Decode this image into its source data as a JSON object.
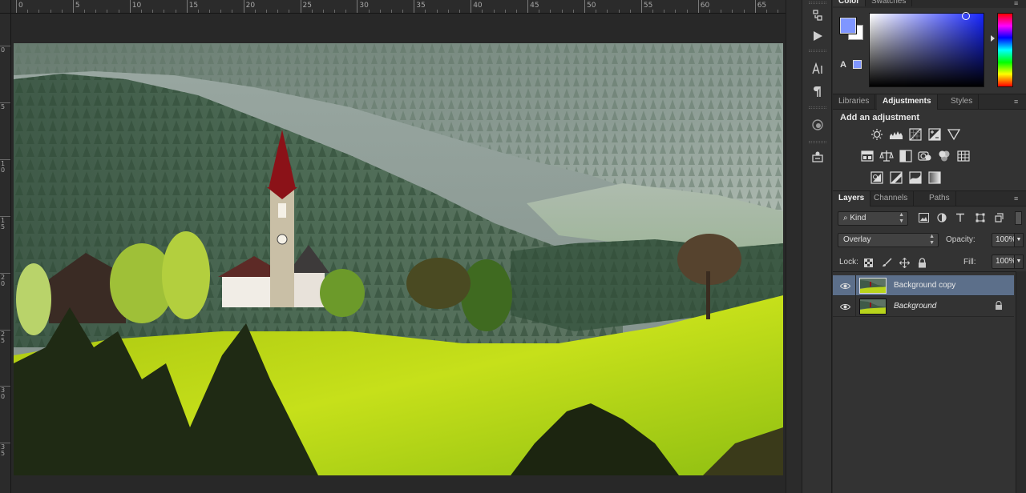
{
  "ruler": {
    "top_labels": [
      "0",
      "5",
      "10",
      "15",
      "20",
      "25",
      "30",
      "35",
      "40",
      "45",
      "50",
      "55",
      "60",
      "65"
    ],
    "left_labels": [
      "0",
      "5",
      "1\n0",
      "1\n5",
      "2\n0",
      "2\n5",
      "3\n0",
      "3\n5"
    ]
  },
  "canvas": {
    "image_description_name": "alpine-village-church-photo"
  },
  "tool_strip": {
    "icons": [
      "history-icon",
      "play-action-icon",
      "character-icon",
      "paragraph-icon",
      "brush-preset-icon",
      "clone-source-icon"
    ]
  },
  "color_panel": {
    "tabs": [
      "Color",
      "Swatches"
    ],
    "foreground_color": "#7f96ff",
    "background_color": "#ffffff",
    "hue_color": "#1726ff"
  },
  "adjustments_panel": {
    "tabs": [
      "Libraries",
      "Adjustments",
      "Styles"
    ],
    "active_tab": "Adjustments",
    "title": "Add an adjustment",
    "row1": [
      "brightness-contrast-icon",
      "levels-icon",
      "curves-icon",
      "exposure-icon",
      "vibrance-icon"
    ],
    "row2": [
      "hue-saturation-icon",
      "color-balance-icon",
      "black-white-icon",
      "photo-filter-icon",
      "channel-mixer-icon",
      "color-lookup-icon"
    ],
    "row3": [
      "invert-icon",
      "posterize-icon",
      "threshold-icon",
      "gradient-map-icon"
    ]
  },
  "layers_panel": {
    "tabs": [
      "Layers",
      "Channels",
      "Paths"
    ],
    "active_tab": "Layers",
    "filter_kind": "Kind",
    "blend_mode": "Overlay",
    "opacity_label": "Opacity:",
    "opacity_value": "100%",
    "lock_label": "Lock:",
    "fill_label": "Fill:",
    "fill_value": "100%",
    "layers": [
      {
        "name": "Background copy",
        "selected": true,
        "italic": false,
        "locked": false
      },
      {
        "name": "Background",
        "selected": false,
        "italic": true,
        "locked": true
      }
    ],
    "selection_color": "#5c6f8a"
  }
}
